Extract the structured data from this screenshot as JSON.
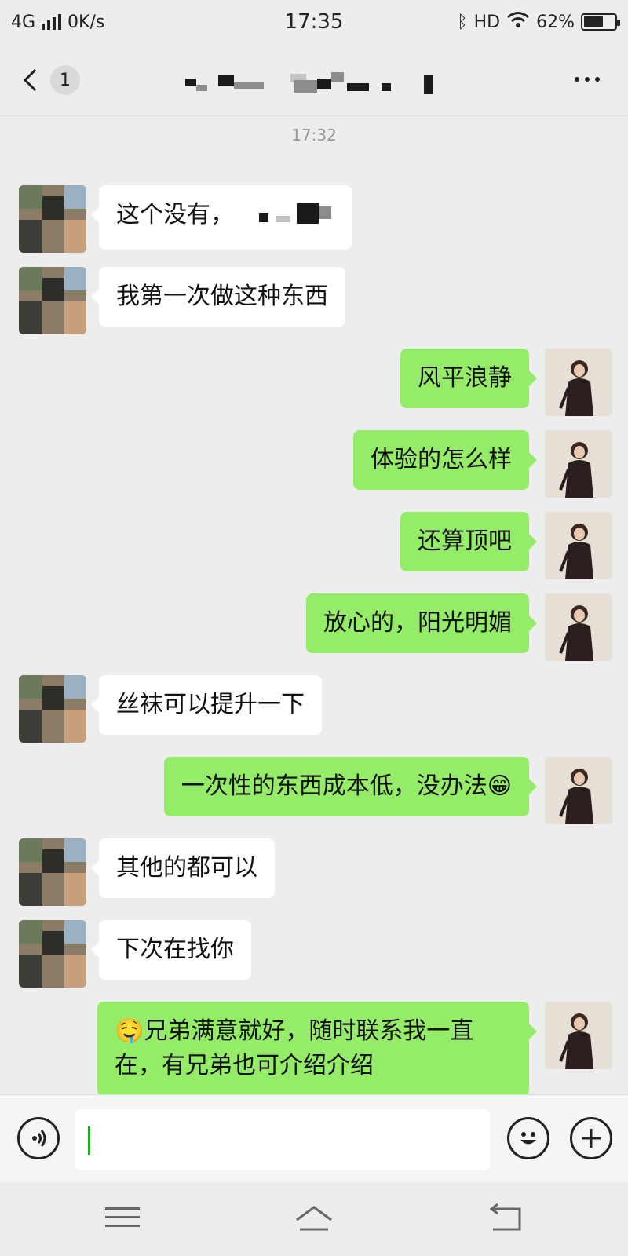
{
  "status_bar": {
    "network": "4G",
    "speed": "0K/s",
    "time": "17:35",
    "hd": "HD",
    "battery": "62%",
    "battery_level": 0.62
  },
  "header": {
    "unread_count": "1",
    "back_icon": "chevron-left-icon",
    "more_icon": "more-dots-icon"
  },
  "chat": {
    "timestamp": "17:32",
    "messages": [
      {
        "side": "in",
        "text": "这个没有，"
      },
      {
        "side": "in",
        "text": "我第一次做这种东西"
      },
      {
        "side": "out",
        "text": "风平浪静"
      },
      {
        "side": "out",
        "text": "体验的怎么样"
      },
      {
        "side": "out",
        "text": "还算顶吧"
      },
      {
        "side": "out",
        "text": "放心的，阳光明媚"
      },
      {
        "side": "in",
        "text": "丝袜可以提升一下"
      },
      {
        "side": "out",
        "text": "一次性的东西成本低，没办法😁"
      },
      {
        "side": "in",
        "text": "其他的都可以"
      },
      {
        "side": "in",
        "text": "下次在找你"
      },
      {
        "side": "out",
        "text": "🤤兄弟满意就好，随时联系我一直在，有兄弟也可介绍介绍"
      }
    ]
  },
  "input_bar": {
    "voice_icon": "voice-icon",
    "emoji_icon": "emoji-icon",
    "plus_icon": "plus-icon",
    "text_value": ""
  },
  "colors": {
    "outgoing_bubble": "#95ec69",
    "incoming_bubble": "#ffffff",
    "background": "#ededed"
  }
}
